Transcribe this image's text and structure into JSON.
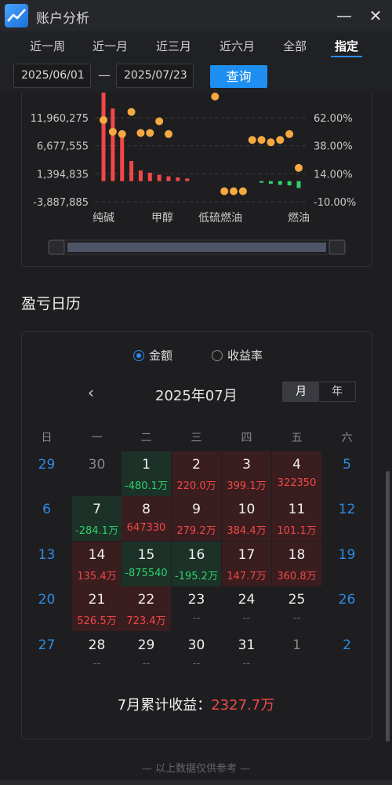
{
  "window": {
    "title": "账户分析",
    "minimize": "—",
    "close": "✕"
  },
  "tabs": [
    "近一周",
    "近一月",
    "近三月",
    "近六月",
    "全部",
    "指定"
  ],
  "active_tab": "指定",
  "date_range": {
    "start": "2025/06/01",
    "separator": "—",
    "end": "2025/07/23",
    "query_label": "查询"
  },
  "chart_data": {
    "type": "bar",
    "left_ticks": [
      "11,960,275",
      "6,677,555",
      "1,394,835",
      "-3,887,885"
    ],
    "left_tick_values": [
      11960275,
      6677555,
      1394835,
      -3887885
    ],
    "right_ticks": [
      "62.00%",
      "38.00%",
      "14.00%",
      "-10.00%"
    ],
    "right_tick_values": [
      62,
      38,
      14,
      -10
    ],
    "category_labels": [
      "纯碱",
      "甲醇",
      "低硫燃油",
      "燃油"
    ],
    "bars": [
      19000000,
      13700000,
      9300000,
      3800000,
      2000000,
      1600000,
      1200000,
      900000,
      700000,
      500000,
      0,
      0,
      0,
      0,
      0,
      0,
      0,
      -300000,
      -500000,
      -700000,
      -800000,
      -1300000
    ],
    "rate": [
      60,
      50,
      48,
      67,
      49,
      49,
      59,
      48,
      null,
      null,
      null,
      null,
      85,
      -1,
      -1,
      -1,
      43,
      43,
      41,
      43,
      48,
      19
    ],
    "bar_colors": {
      "positive": "#f04848",
      "negative": "#2fd06a"
    },
    "point_color": "#f5a940"
  },
  "calendar": {
    "section_title": "盈亏日历",
    "radio_amount": "金额",
    "radio_rate": "收益率",
    "selected_radio": "金额",
    "prev_icon": "‹",
    "month_title": "2025年07月",
    "view_month": "月",
    "view_year": "年",
    "weekdays": [
      "日",
      "一",
      "二",
      "三",
      "四",
      "五",
      "六"
    ],
    "weeks": [
      [
        {
          "day": "29",
          "pnl": "",
          "type": "weekend"
        },
        {
          "day": "30",
          "pnl": "",
          "type": "other"
        },
        {
          "day": "1",
          "pnl": "-480.1万",
          "type": "down"
        },
        {
          "day": "2",
          "pnl": "220.0万",
          "type": "up"
        },
        {
          "day": "3",
          "pnl": "399.1万",
          "type": "up"
        },
        {
          "day": "4",
          "pnl": "322350",
          "type": "up"
        },
        {
          "day": "5",
          "pnl": "",
          "type": "weekend"
        }
      ],
      [
        {
          "day": "6",
          "pnl": "",
          "type": "weekend"
        },
        {
          "day": "7",
          "pnl": "-284.1万",
          "type": "down"
        },
        {
          "day": "8",
          "pnl": "647330",
          "type": "up"
        },
        {
          "day": "9",
          "pnl": "279.2万",
          "type": "up"
        },
        {
          "day": "10",
          "pnl": "384.4万",
          "type": "up"
        },
        {
          "day": "11",
          "pnl": "101.1万",
          "type": "up"
        },
        {
          "day": "12",
          "pnl": "",
          "type": "weekend"
        }
      ],
      [
        {
          "day": "13",
          "pnl": "",
          "type": "weekend"
        },
        {
          "day": "14",
          "pnl": "135.4万",
          "type": "up"
        },
        {
          "day": "15",
          "pnl": "-875540",
          "type": "down"
        },
        {
          "day": "16",
          "pnl": "-195.2万",
          "type": "down"
        },
        {
          "day": "17",
          "pnl": "147.7万",
          "type": "up"
        },
        {
          "day": "18",
          "pnl": "360.8万",
          "type": "up"
        },
        {
          "day": "19",
          "pnl": "",
          "type": "weekend"
        }
      ],
      [
        {
          "day": "20",
          "pnl": "",
          "type": "weekend"
        },
        {
          "day": "21",
          "pnl": "526.5万",
          "type": "up"
        },
        {
          "day": "22",
          "pnl": "723.4万",
          "type": "up"
        },
        {
          "day": "23",
          "pnl": "--",
          "type": "none"
        },
        {
          "day": "24",
          "pnl": "--",
          "type": "none"
        },
        {
          "day": "25",
          "pnl": "--",
          "type": "none"
        },
        {
          "day": "26",
          "pnl": "",
          "type": "weekend"
        }
      ],
      [
        {
          "day": "27",
          "pnl": "",
          "type": "weekend"
        },
        {
          "day": "28",
          "pnl": "--",
          "type": "none"
        },
        {
          "day": "29",
          "pnl": "--",
          "type": "none"
        },
        {
          "day": "30",
          "pnl": "--",
          "type": "none"
        },
        {
          "day": "31",
          "pnl": "--",
          "type": "none"
        },
        {
          "day": "1",
          "pnl": "",
          "type": "other"
        },
        {
          "day": "2",
          "pnl": "",
          "type": "weekend"
        }
      ]
    ],
    "summary_label": "7月累计收益：",
    "summary_value": "2327.7万"
  },
  "footnote": "— 以上数据仅供参考 —"
}
